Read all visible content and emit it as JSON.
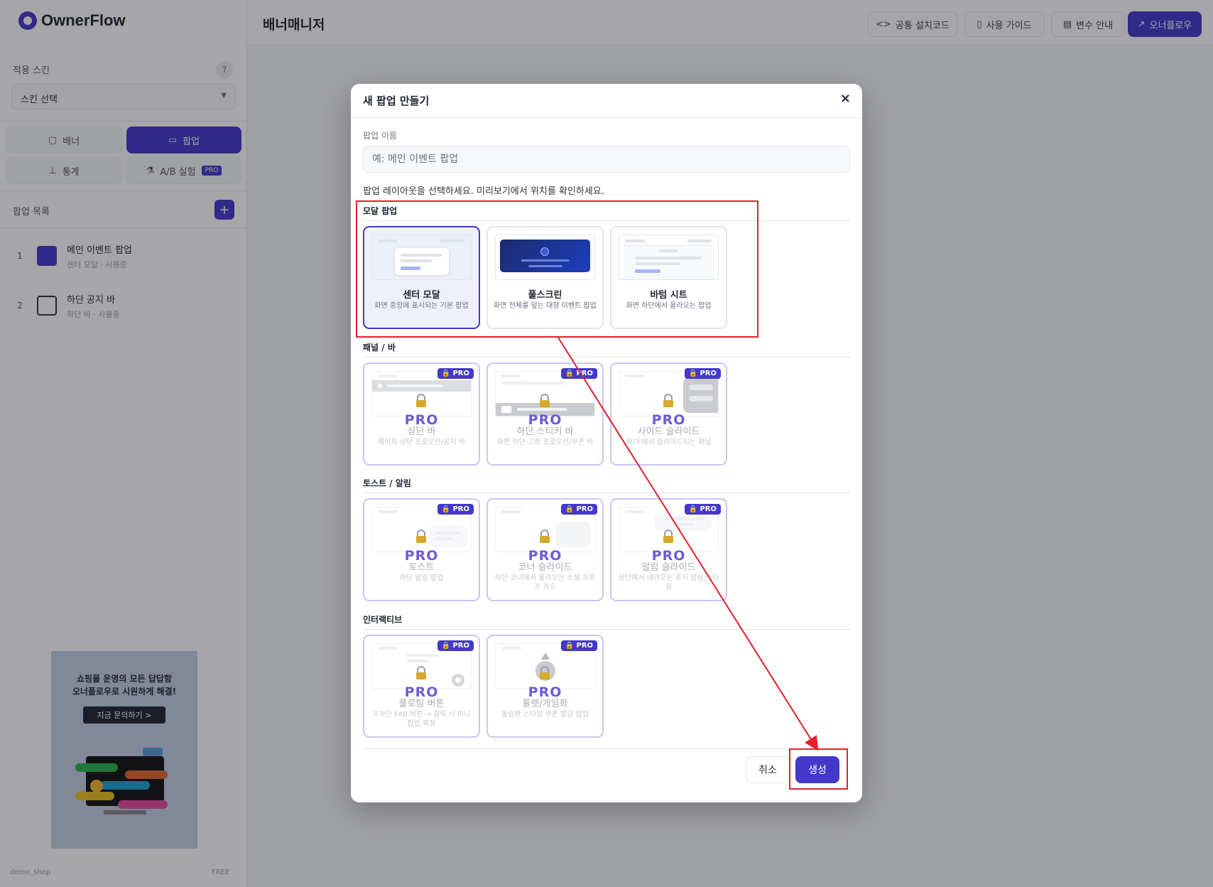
{
  "app": {
    "logo": "OwnerFlow",
    "page_title": "배너매니저",
    "top_buttons": [
      "공통 설치코드",
      "사용 가이드",
      "변수 안내",
      "오너플로우"
    ]
  },
  "sidebar": {
    "skin_label": "적용 스킨",
    "help": "?",
    "skin_select": "스킨 선택",
    "nav": {
      "banner": "배너",
      "popup": "팝업",
      "stats": "통계",
      "ab": "A/B 실험",
      "ab_badge": "PRO"
    },
    "list_title": "팝업 목록",
    "add": "+",
    "items": [
      {
        "num": "1",
        "title": "메인 이벤트 팝업",
        "sub": "센터 모달 · 사용중"
      },
      {
        "num": "2",
        "title": "하단 공지 바",
        "sub": "하단 바 · 사용중"
      }
    ],
    "promo": {
      "line1": "쇼핑몰 운영의 모든 답답함",
      "line2": "오너플로우로 시원하게 해결!",
      "button": "지금 문의하기 >"
    },
    "footer_left": "demo_shop",
    "footer_right": "FREE"
  },
  "modal": {
    "title": "새 팝업 만들기",
    "close": "×",
    "name_label": "팝업 이름",
    "name_placeholder": "예: 메인 이벤트 팝업",
    "instruction": "팝업 레이아웃을 선택하세요. 미리보기에서 위치를 확인하세요.",
    "pro_tag": "PRO",
    "pro_big": "PRO",
    "sections": [
      {
        "title": "모달 팝업",
        "cards": [
          {
            "title": "센터 모달",
            "desc": "화면 중앙에 표시되는 기본 팝업"
          },
          {
            "title": "풀스크린",
            "desc": "화면 전체를 덮는 대형 이벤트 팝업"
          },
          {
            "title": "바텀 시트",
            "desc": "화면 하단에서 올라오는 팝업"
          }
        ]
      },
      {
        "title": "패널 / 바",
        "cards": [
          {
            "title": "상단 바",
            "desc": "페이지 상단 프로모션/공지 바"
          },
          {
            "title": "하단 스티키 바",
            "desc": "화면 하단 고정 프로모션/쿠폰 바"
          },
          {
            "title": "사이드 슬라이드",
            "desc": "좌/우에서 슬라이드되는 패널"
          }
        ]
      },
      {
        "title": "토스트 / 알림",
        "cards": [
          {
            "title": "토스트",
            "desc": "하단 알림 팝업"
          },
          {
            "title": "코너 슬라이드",
            "desc": "하단 코너에서 올라오는 소셜 프루프 카드"
          },
          {
            "title": "알림 슬라이드",
            "desc": "상단에서 내려오는 푸시 알림 스타일"
          }
        ]
      },
      {
        "title": "인터랙티브",
        "cards": [
          {
            "title": "플로팅 버튼",
            "desc": "우하단 FAB 버튼 → 클릭 시 미니 팝업 확장"
          },
          {
            "title": "룰렛/게임화",
            "desc": "돌림판 스타일 쿠폰 발급 팝업"
          }
        ]
      }
    ],
    "cancel": "취소",
    "create": "생성"
  },
  "colors": {
    "accent": "#4338ca",
    "annotation": "#e4202a"
  }
}
